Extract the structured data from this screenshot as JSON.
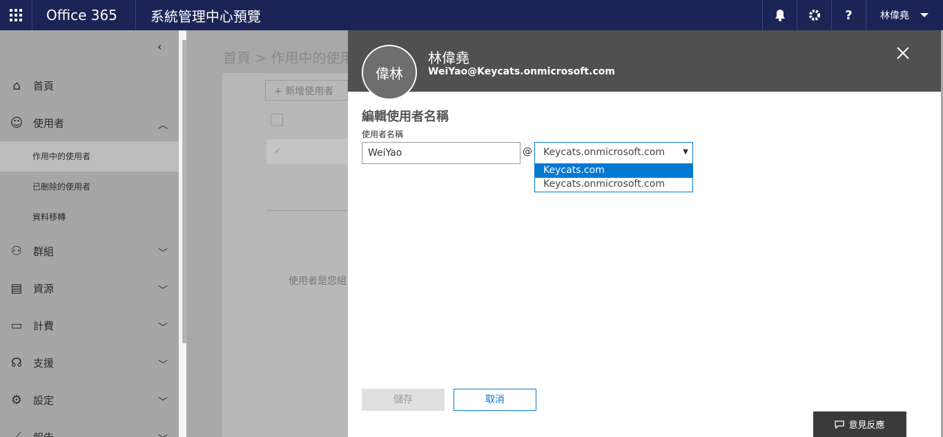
{
  "topbar": {
    "brand": "Office 365",
    "title": "系統管理中心預覽",
    "user": "林偉堯"
  },
  "sidebar": {
    "items": [
      {
        "label": "首頁",
        "icon": "home-icon"
      },
      {
        "label": "使用者",
        "icon": "person-icon",
        "expanded": true,
        "children": [
          {
            "label": "作用中的使用者",
            "active": true
          },
          {
            "label": "已刪除的使用者"
          },
          {
            "label": "資料移轉"
          }
        ]
      },
      {
        "label": "群組",
        "icon": "group-icon"
      },
      {
        "label": "資源",
        "icon": "resources-icon"
      },
      {
        "label": "計費",
        "icon": "billing-icon"
      },
      {
        "label": "支援",
        "icon": "headset-icon"
      },
      {
        "label": "設定",
        "icon": "gear-icon"
      },
      {
        "label": "報告",
        "icon": "reports-icon"
      }
    ]
  },
  "background": {
    "breadcrumb": "首頁 > 作用中的使用",
    "add_user": "新增使用者",
    "empty_text": "使用者是您組"
  },
  "panel": {
    "avatar_initials": "偉林",
    "name": "林偉堯",
    "email": "WeiYao@Keycats.onmicrosoft.com",
    "section_title": "編輯使用者名稱",
    "username_label": "使用者名稱",
    "username_value": "WeiYao",
    "at": "@",
    "domain_selected": "Keycats.onmicrosoft.com",
    "domain_options": [
      "Keycats.com",
      "Keycats.onmicrosoft.com"
    ],
    "save_label": "儲存",
    "cancel_label": "取消"
  },
  "feedback_label": "意見反應",
  "colors": {
    "topbar": "#1c2456",
    "accent": "#0078d4",
    "panel_header": "#505050"
  }
}
